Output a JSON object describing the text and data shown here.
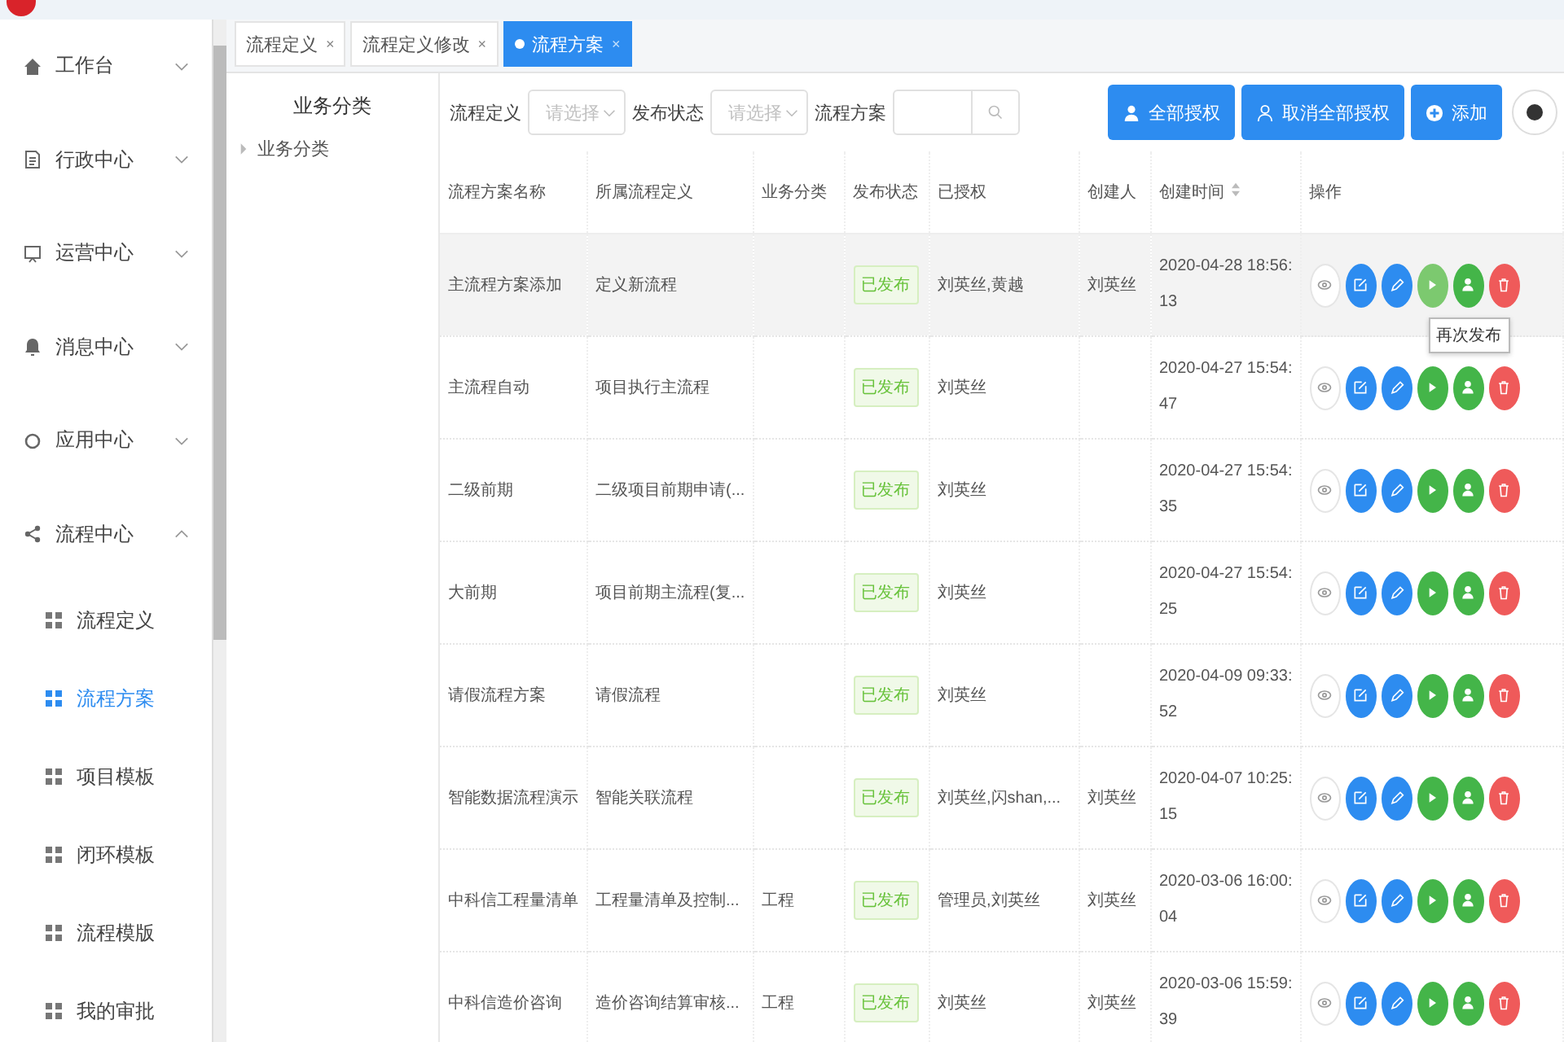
{
  "sidebar": {
    "items": [
      {
        "label": "工作台",
        "expanded": false
      },
      {
        "label": "行政中心",
        "expanded": false
      },
      {
        "label": "运营中心",
        "expanded": false
      },
      {
        "label": "消息中心",
        "expanded": false
      },
      {
        "label": "应用中心",
        "expanded": false
      },
      {
        "label": "流程中心",
        "expanded": true,
        "children": [
          {
            "label": "流程定义",
            "selected": false
          },
          {
            "label": "流程方案",
            "selected": true
          },
          {
            "label": "项目模板",
            "selected": false
          },
          {
            "label": "闭环模板",
            "selected": false
          },
          {
            "label": "流程模版",
            "selected": false
          },
          {
            "label": "我的审批",
            "selected": false
          }
        ]
      }
    ]
  },
  "tabs": [
    {
      "label": "流程定义",
      "close": "×",
      "selected": false
    },
    {
      "label": "流程定义修改",
      "close": "×",
      "selected": false
    },
    {
      "label": "流程方案",
      "close": "×",
      "selected": true
    }
  ],
  "tree": {
    "title": "业务分类",
    "items": [
      {
        "label": "业务分类",
        "expanded": false
      }
    ]
  },
  "filters": [
    {
      "label": "流程定义",
      "placeholder": "请选择",
      "kind": "select"
    },
    {
      "label": "发布状态",
      "placeholder": "请选择",
      "kind": "select"
    },
    {
      "label": "流程方案",
      "kind": "search"
    }
  ],
  "buttons": [
    {
      "label": "全部授权"
    },
    {
      "label": "取消全部授权"
    },
    {
      "label": "添加"
    }
  ],
  "table": {
    "columns": [
      "流程方案名称",
      "所属流程定义",
      "业务分类",
      "发布状态",
      "已授权",
      "创建人",
      "创建时间",
      "操作"
    ],
    "rows": [
      {
        "name": "主流程方案添加",
        "definition": "定义新流程",
        "category": "",
        "status": "已发布",
        "authorized": "刘英丝,黄越",
        "creator": "刘英丝",
        "created": "2020-04-28 18:56:13",
        "highlighted": true,
        "tooltip": "再次发布"
      },
      {
        "name": "主流程自动",
        "definition": "项目执行主流程",
        "category": "",
        "status": "已发布",
        "authorized": "刘英丝",
        "creator": "",
        "created": "2020-04-27 15:54:47",
        "highlighted": false
      },
      {
        "name": "二级前期",
        "definition": "二级项目前期申请(...",
        "category": "",
        "status": "已发布",
        "authorized": "刘英丝",
        "creator": "",
        "created": "2020-04-27 15:54:35",
        "highlighted": false
      },
      {
        "name": "大前期",
        "definition": "项目前期主流程(复...",
        "category": "",
        "status": "已发布",
        "authorized": "刘英丝",
        "creator": "",
        "created": "2020-04-27 15:54:25",
        "highlighted": false
      },
      {
        "name": "请假流程方案",
        "definition": "请假流程",
        "category": "",
        "status": "已发布",
        "authorized": "刘英丝",
        "creator": "",
        "created": "2020-04-09 09:33:52",
        "highlighted": false
      },
      {
        "name": "智能数据流程演示",
        "definition": "智能关联流程",
        "category": "",
        "status": "已发布",
        "authorized": "刘英丝,闪shan,...",
        "creator": "刘英丝",
        "created": "2020-04-07 10:25:15",
        "highlighted": false
      },
      {
        "name": "中科信工程量清单",
        "definition": "工程量清单及控制...",
        "category": "工程",
        "status": "已发布",
        "authorized": "管理员,刘英丝",
        "creator": "刘英丝",
        "created": "2020-03-06 16:00:04",
        "highlighted": false
      },
      {
        "name": "中科信造价咨询",
        "definition": "造价咨询结算审核...",
        "category": "工程",
        "status": "已发布",
        "authorized": "刘英丝",
        "creator": "刘英丝",
        "created": "2020-03-06 15:59:39",
        "highlighted": false
      }
    ]
  }
}
